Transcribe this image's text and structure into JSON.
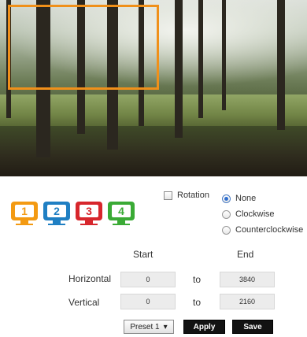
{
  "preview": {
    "roi_color": "#f0901a"
  },
  "monitors": [
    {
      "label": "1",
      "color": "#f39a12"
    },
    {
      "label": "2",
      "color": "#1f7fc3"
    },
    {
      "label": "3",
      "color": "#d7262c"
    },
    {
      "label": "4",
      "color": "#3aaa35"
    }
  ],
  "rotation": {
    "label": "Rotation",
    "checked": false
  },
  "direction": {
    "selected": "None",
    "options": [
      "None",
      "Clockwise",
      "Counterclockwise"
    ]
  },
  "headers": {
    "start": "Start",
    "end": "End"
  },
  "rows": [
    {
      "label": "Horizontal",
      "start": "0",
      "to": "to",
      "end": "3840"
    },
    {
      "label": "Vertical",
      "start": "0",
      "to": "to",
      "end": "2160"
    }
  ],
  "preset": {
    "value": "Preset 1",
    "arrow": "▾"
  },
  "buttons": {
    "apply": "Apply",
    "save": "Save"
  }
}
